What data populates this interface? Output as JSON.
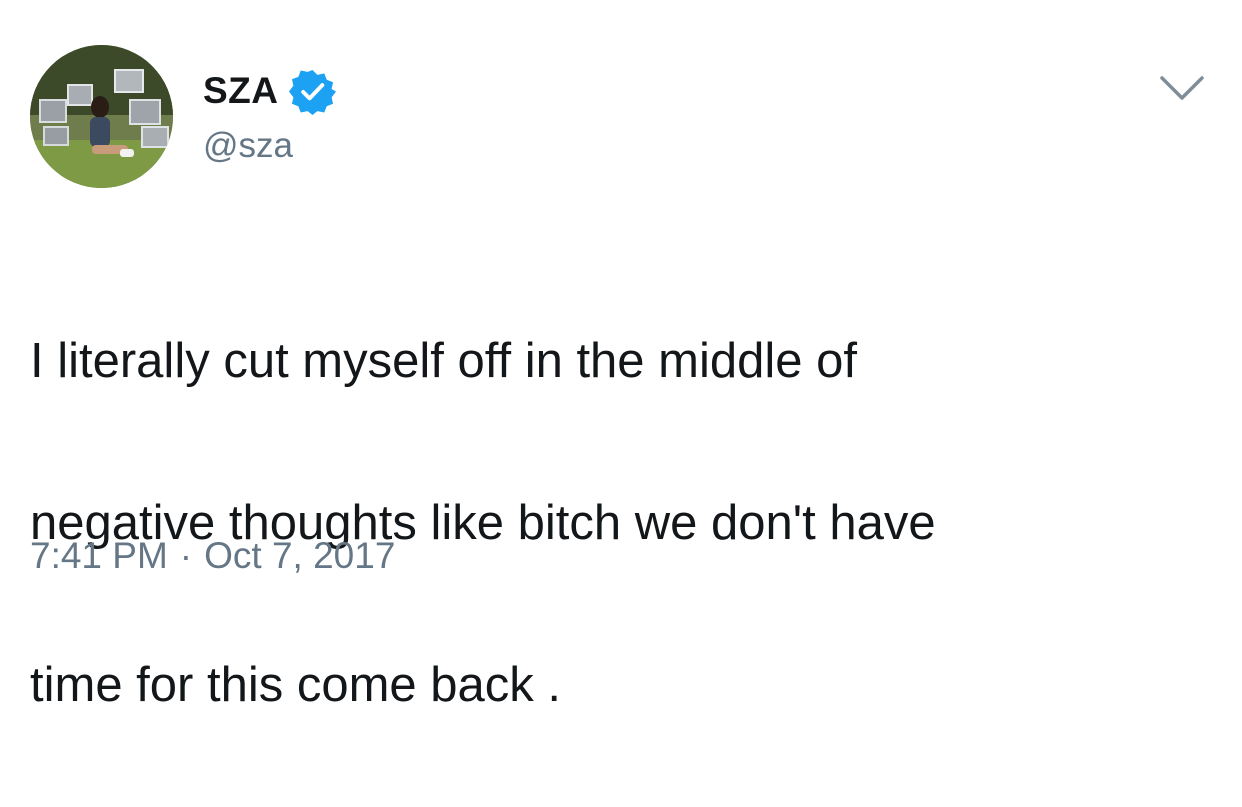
{
  "user": {
    "display_name": "SZA",
    "handle": "@sza",
    "verified": true,
    "avatar_icon": "profile-photo",
    "verified_icon": "verified-badge-icon"
  },
  "tweet": {
    "text_lines": [
      "I literally cut myself off in the middle of",
      "negative thoughts like bitch we don't have",
      "time for this come back ."
    ],
    "time": "7:41 PM",
    "separator": "·",
    "date": "Oct 7, 2017"
  },
  "menu": {
    "icon": "chevron-down-icon"
  },
  "colors": {
    "text": "#14171a",
    "secondary": "#657786",
    "verified_blue": "#1da1f2",
    "background": "#ffffff"
  }
}
